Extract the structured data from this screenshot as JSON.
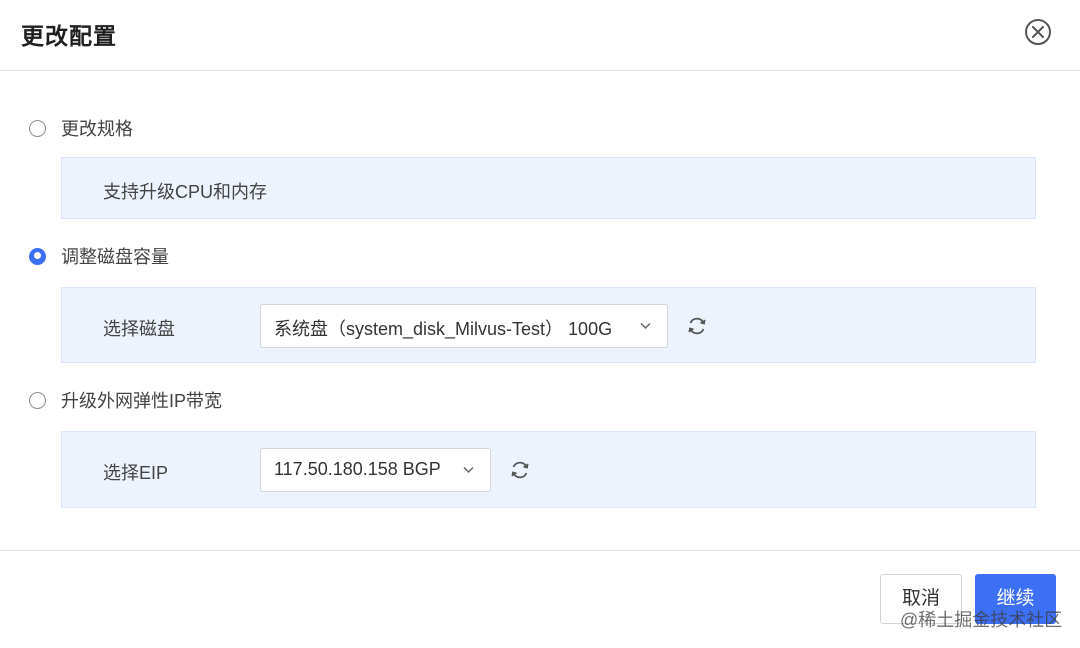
{
  "dialog": {
    "title": "更改配置",
    "close_icon": "close-circle-icon"
  },
  "options": [
    {
      "label": "更改规格",
      "checked": false,
      "description": "支持升级CPU和内存"
    },
    {
      "label": "调整磁盘容量",
      "checked": true,
      "field_label": "选择磁盘",
      "select_value": "系统盘（system_disk_Milvus-Test） 100G"
    },
    {
      "label": "升级外网弹性IP带宽",
      "checked": false,
      "field_label": "选择EIP",
      "select_value": "117.50.180.158 BGP"
    }
  ],
  "footer": {
    "cancel_label": "取消",
    "continue_label": "继续"
  },
  "watermark": "@稀土掘金技术社区",
  "colors": {
    "accent": "#3d6ff5",
    "panel_bg": "#edf3fd"
  }
}
